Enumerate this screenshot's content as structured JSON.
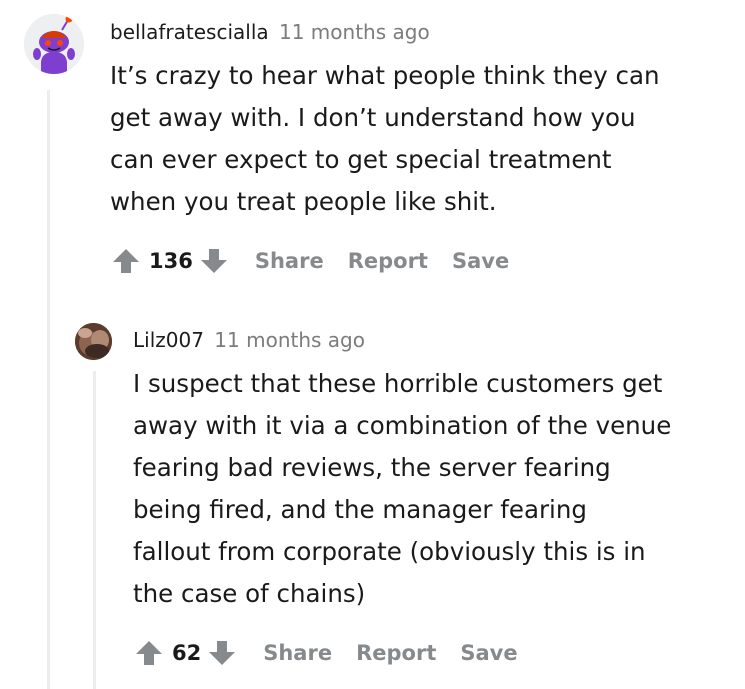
{
  "comments": [
    {
      "author": "bellafratescialla",
      "time": "11 months ago",
      "avatar": "reddit-snoo-avatar-purple",
      "lines": [
        "It’s crazy to hear what people think they can",
        "get away with. I don’t understand how you",
        "can ever expect to get special treatment",
        "when you treat people like shit."
      ],
      "score": "136",
      "actions": [
        "Share",
        "Report",
        "Save"
      ]
    },
    {
      "author": "Lilz007",
      "time": "11 months ago",
      "avatar": "user-photo-avatar",
      "lines": [
        "I suspect that these horrible customers get",
        "away with it via a combination of the venue",
        "fearing bad reviews, the server fearing",
        "being fired, and the manager fearing",
        "fallout from corporate (obviously this is in",
        "the case of chains)"
      ],
      "score": "62",
      "actions": [
        "Share",
        "Report",
        "Save"
      ]
    }
  ],
  "colors": {
    "vote_icon": "#878a8c",
    "thread_line": "#ededed",
    "snoo_body": "#7e3fd1",
    "snoo_accent": "#ff4500"
  }
}
